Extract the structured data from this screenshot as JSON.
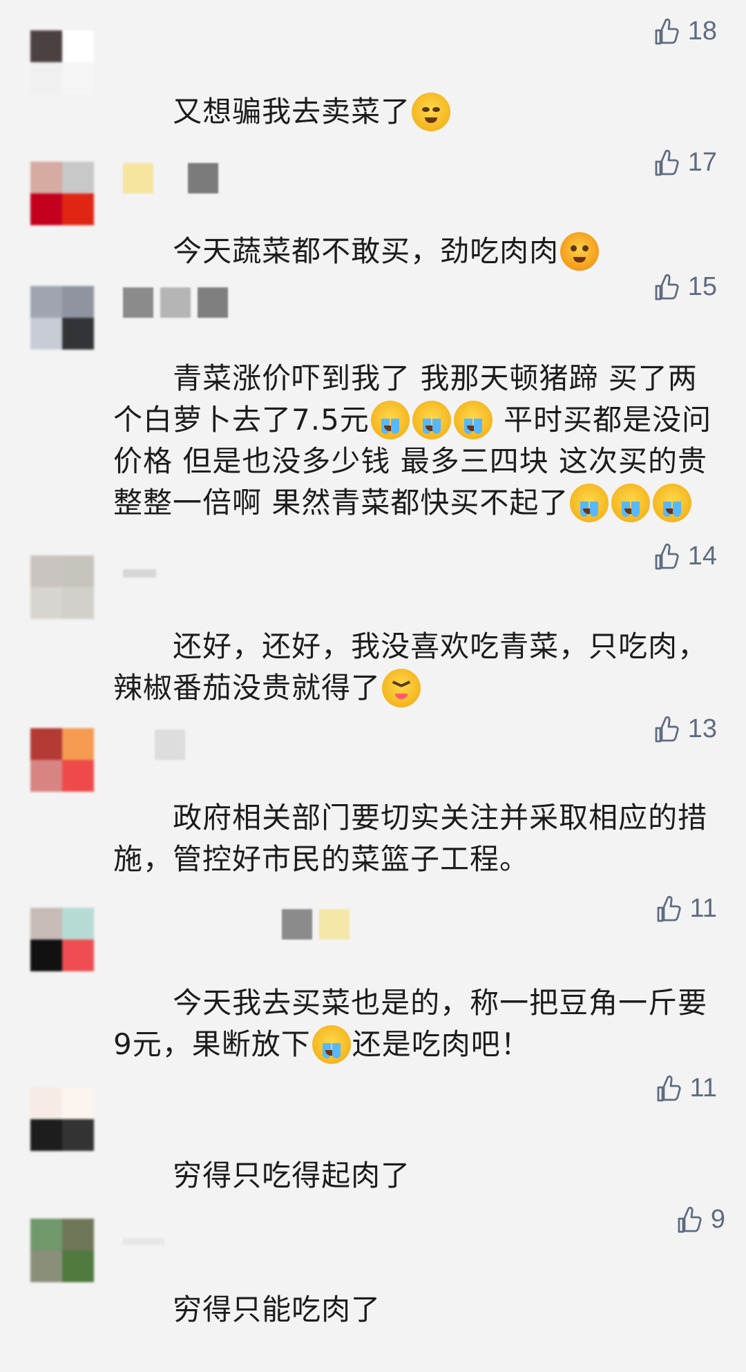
{
  "comments": [
    {
      "avatar_colors": [
        "#4b4141",
        "#ffffff",
        "#f0f0f0",
        "#f5f5f5"
      ],
      "username_colors": [],
      "likes": "18",
      "text_prefix": "又想骗我去卖菜了",
      "emoji": "smirk-emoji",
      "text_suffix": ""
    },
    {
      "avatar_colors": [
        "#d6aba2",
        "#c8c8c8",
        "#c4001f",
        "#e02613"
      ],
      "username_colors": [
        "#f6e59f",
        "#7b7b7b"
      ],
      "likes": "17",
      "text_prefix": "今天蔬菜都不敢买，劲吃肉肉",
      "emoji": "blush-emoji",
      "text_suffix": ""
    },
    {
      "avatar_colors": [
        "#9fa4b0",
        "#8f94a0",
        "#c7ccd5",
        "#323437"
      ],
      "username_colors": [
        "#8b8b8b",
        "#b5b5b5",
        "#7f7f7f"
      ],
      "likes": "15",
      "text_prefix": "青菜涨价吓到我了 我那天顿猪蹄 买了两个白萝卜去了7.5元",
      "emoji": "crying-emoji",
      "emoji_repeat": 3,
      "text_suffix": " 平时买都是没问价格 但是也没多少钱 最多三四块 这次买的贵整整一倍啊 果然青菜都快买不起了",
      "emoji2": "crying-emoji",
      "emoji2_repeat": 3
    },
    {
      "avatar_colors": [
        "#c9c4bf",
        "#c7c3bd",
        "#d8d4cf",
        "#d2d0ca"
      ],
      "username_colors": [
        "#d7d7d7"
      ],
      "likes": "14",
      "text_prefix": "还好，还好，我没喜欢吃青菜，只吃肉，辣椒番茄没贵就得了",
      "emoji": "tongue-emoji",
      "text_suffix": ""
    },
    {
      "avatar_colors": [
        "#b43b35",
        "#f59b52",
        "#d88483",
        "#ef4a4a"
      ],
      "username_colors": [
        "#dddddd"
      ],
      "likes": "13",
      "text_prefix": "政府相关部门要切实关注并采取相应的措施，管控好市民的菜篮子工程。",
      "emoji": "",
      "text_suffix": ""
    },
    {
      "avatar_colors": [
        "#c7bbb8",
        "#b6dbd4",
        "#111111",
        "#ef4d52"
      ],
      "username_colors": [
        "#8b8b8b",
        "#f4e7a7"
      ],
      "likes": "11",
      "text_prefix": "今天我去买菜也是的，称一把豆角一斤要9元，果断放下",
      "emoji": "laughing-crying-emoji",
      "text_suffix": "还是吃肉吧！"
    },
    {
      "avatar_colors": [
        "#f7ece5",
        "#fbf4ef",
        "#1d1d1d",
        "#333333"
      ],
      "username_colors": [],
      "likes": "11",
      "text_prefix": "穷得只吃得起肉了",
      "emoji": "",
      "text_suffix": ""
    },
    {
      "avatar_colors": [
        "#6f986b",
        "#707658",
        "#8a8f7a",
        "#4f7b3e"
      ],
      "username_colors": [
        "#e7e7e7"
      ],
      "likes": "9",
      "text_prefix": "穷得只能吃肉了",
      "emoji": "",
      "text_suffix": ""
    }
  ],
  "icons": {
    "like": "thumbs-up-icon"
  }
}
